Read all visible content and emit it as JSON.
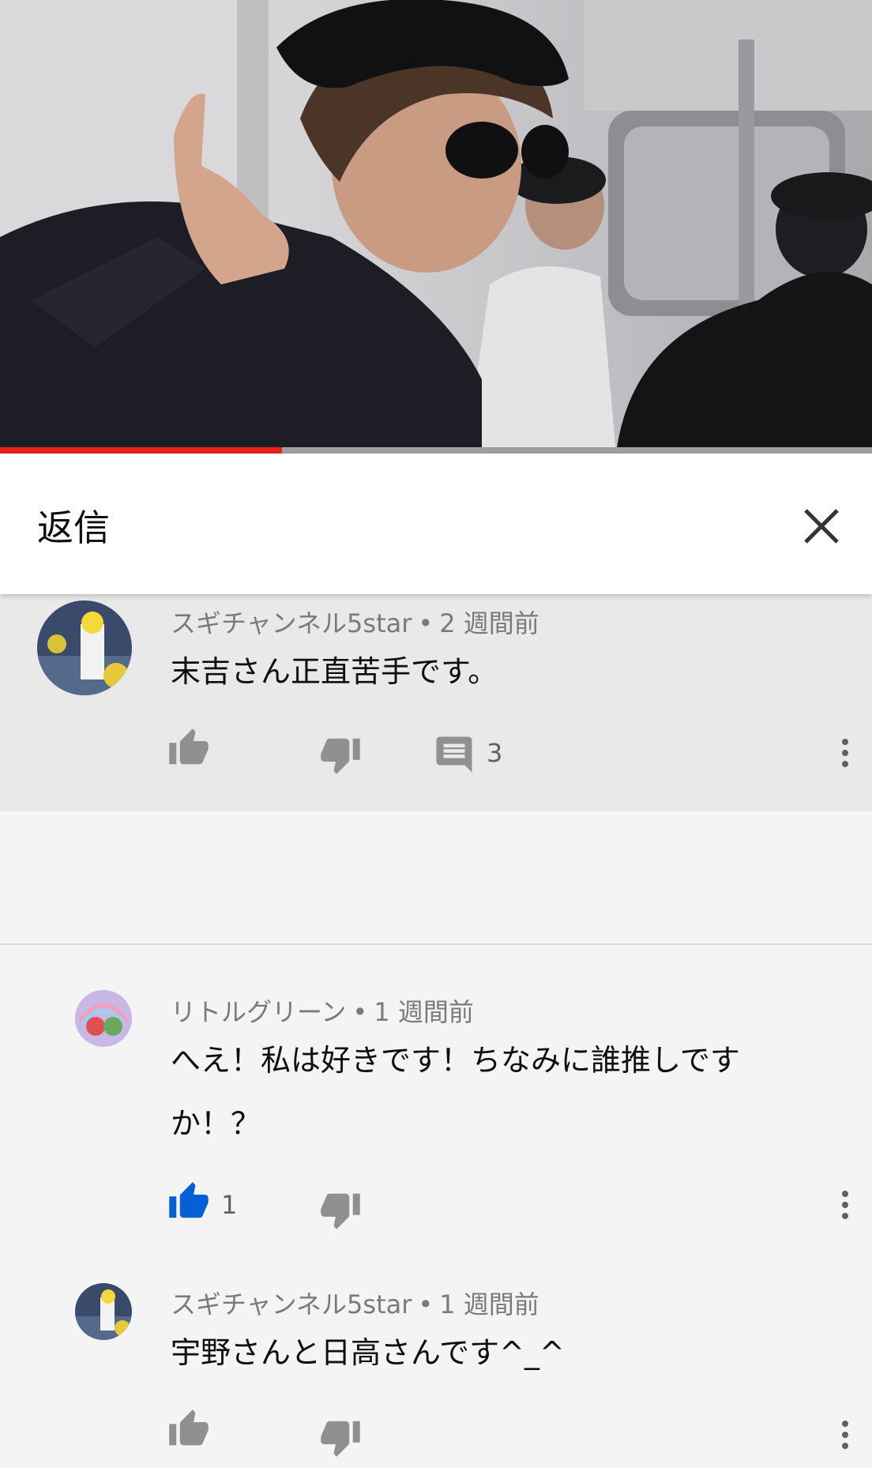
{
  "video": {
    "progress_fraction": 0.323
  },
  "panel": {
    "title": "返信",
    "close_icon": "close-icon"
  },
  "parent_comment": {
    "author": "スギチャンネル5star",
    "time": "2 週間前",
    "text": "末吉さん正直苦手です。",
    "reply_count": "3",
    "like_icon": "thumb-up-icon",
    "dislike_icon": "thumb-down-icon",
    "reply_icon": "comment-icon"
  },
  "replies": [
    {
      "author": "リトルグリーン",
      "time": "1 週間前",
      "text_line1": "へえ！私は好きです！ちなみに誰推しです",
      "text_line2": "か！？",
      "like_count": "1",
      "liked": true
    },
    {
      "author": "スギチャンネル5star",
      "time": "1 週間前",
      "text": "宇野さんと日高さんです^_^",
      "liked": false
    }
  ],
  "separator": "•",
  "colors": {
    "progress": "#e62117",
    "like_active": "#065fd4",
    "icon_gray": "#909090"
  }
}
